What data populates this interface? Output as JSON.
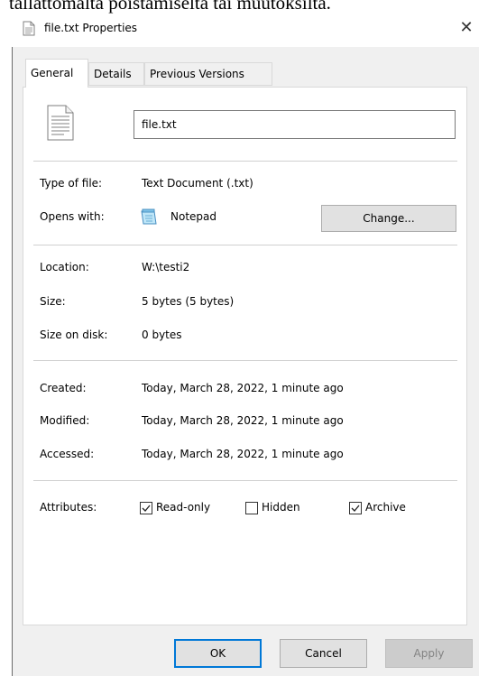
{
  "background_text": "tallattomalta poistamiselta tai muutoksilta.",
  "window": {
    "title": "file.txt Properties",
    "close_glyph": "✕"
  },
  "tabs": [
    {
      "label": "General",
      "active": true
    },
    {
      "label": "Details",
      "active": false
    },
    {
      "label": "Previous Versions",
      "active": false
    }
  ],
  "file": {
    "name": "file.txt",
    "icon": "text-file-icon"
  },
  "info": {
    "type_label": "Type of file:",
    "type_value": "Text Document (.txt)",
    "opens_label": "Opens with:",
    "opens_value": "Notepad",
    "opens_icon": "notepad-icon",
    "change_button": "Change...",
    "location_label": "Location:",
    "location_value": "W:\\testi2",
    "size_label": "Size:",
    "size_value": "5 bytes (5 bytes)",
    "size_disk_label": "Size on disk:",
    "size_disk_value": "0 bytes",
    "created_label": "Created:",
    "created_value": "Today, March 28, 2022, 1 minute ago",
    "modified_label": "Modified:",
    "modified_value": "Today, March 28, 2022, 1 minute ago",
    "accessed_label": "Accessed:",
    "accessed_value": "Today, March 28, 2022, 1 minute ago"
  },
  "attributes": {
    "label": "Attributes:",
    "read_only": {
      "label": "Read-only",
      "checked": true
    },
    "hidden": {
      "label": "Hidden",
      "checked": false
    },
    "archive": {
      "label": "Archive",
      "checked": true
    }
  },
  "footer": {
    "ok": "OK",
    "cancel": "Cancel",
    "apply": "Apply"
  },
  "colors": {
    "accent": "#0078d7",
    "dialog_bg": "#f0f0f0",
    "panel_bg": "#ffffff"
  }
}
